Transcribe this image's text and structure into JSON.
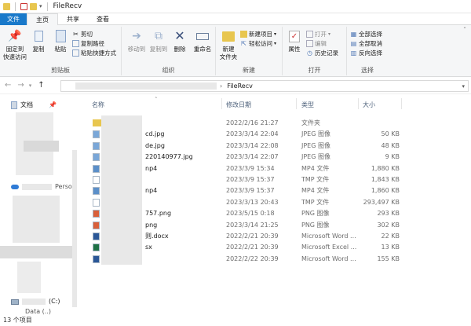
{
  "window": {
    "title": "FileRecv"
  },
  "tabs": [
    "文件",
    "主页",
    "共享",
    "查看"
  ],
  "ribbon": {
    "clipboard": {
      "label": "剪贴板",
      "pin": "固定到\n快速访问",
      "copy": "复制",
      "paste": "粘贴",
      "cut": "剪切",
      "copy_path": "复制路径",
      "paste_shortcut": "粘贴快捷方式"
    },
    "organize": {
      "label": "组织",
      "move_to": "移动到",
      "copy_to": "复制到",
      "delete": "删除",
      "rename": "重命名"
    },
    "new": {
      "label": "新建",
      "new_folder": "新建\n文件夹",
      "new_item": "新建项目",
      "easy_access": "轻松访问"
    },
    "open": {
      "label": "打开",
      "properties": "属性",
      "open": "打开",
      "edit": "编辑",
      "history": "历史记录"
    },
    "select": {
      "label": "选择",
      "select_all": "全部选择",
      "select_none": "全部取消",
      "invert": "反向选择"
    }
  },
  "address": {
    "current": "FileRecv"
  },
  "sidebar": {
    "documents": "文档",
    "persona": "Perso",
    "drive_c": "(C:)",
    "data": "Data (..)"
  },
  "columns": {
    "name": "名称",
    "modified": "修改日期",
    "type": "类型",
    "size": "大小"
  },
  "files": [
    {
      "name": "",
      "date": "2022/2/16 21:27",
      "type": "文件夹",
      "size": "",
      "color": "#e8c64f"
    },
    {
      "name": "cd.jpg",
      "date": "2023/3/14 22:04",
      "type": "JPEG 图像",
      "size": "50 KB",
      "color": "#7aa7d8"
    },
    {
      "name": "de.jpg",
      "date": "2023/3/14 22:08",
      "type": "JPEG 图像",
      "size": "48 KB",
      "color": "#7aa7d8"
    },
    {
      "name": "220140977.jpg",
      "date": "2023/3/14 22:07",
      "type": "JPEG 图像",
      "size": "9 KB",
      "color": "#7aa7d8"
    },
    {
      "name": "np4",
      "date": "2023/3/9 15:34",
      "type": "MP4 文件",
      "size": "1,880 KB",
      "color": "#5b8fc9"
    },
    {
      "name": "",
      "date": "2023/3/9 15:37",
      "type": "TMP 文件",
      "size": "1,843 KB",
      "color": "#ffffff"
    },
    {
      "name": "np4",
      "date": "2023/3/9 15:37",
      "type": "MP4 文件",
      "size": "1,860 KB",
      "color": "#5b8fc9"
    },
    {
      "name": "",
      "date": "2023/3/13 20:43",
      "type": "TMP 文件",
      "size": "293,497 KB",
      "color": "#ffffff"
    },
    {
      "name": "757.png",
      "date": "2023/5/15 0:18",
      "type": "PNG 图像",
      "size": "293 KB",
      "color": "#d9603b"
    },
    {
      "name": "png",
      "date": "2023/3/14 21:25",
      "type": "PNG 图像",
      "size": "302 KB",
      "color": "#d9603b"
    },
    {
      "name": "则.docx",
      "date": "2022/2/21 20:39",
      "type": "Microsoft Word ...",
      "size": "22 KB",
      "color": "#2b5797"
    },
    {
      "name": "sx",
      "date": "2022/2/21 20:39",
      "type": "Microsoft Excel ...",
      "size": "13 KB",
      "color": "#1e7145"
    },
    {
      "name": "",
      "date": "2022/2/22 20:39",
      "type": "Microsoft Word ...",
      "size": "155 KB",
      "color": "#2b5797"
    }
  ],
  "status": {
    "count": "13 个项目"
  }
}
